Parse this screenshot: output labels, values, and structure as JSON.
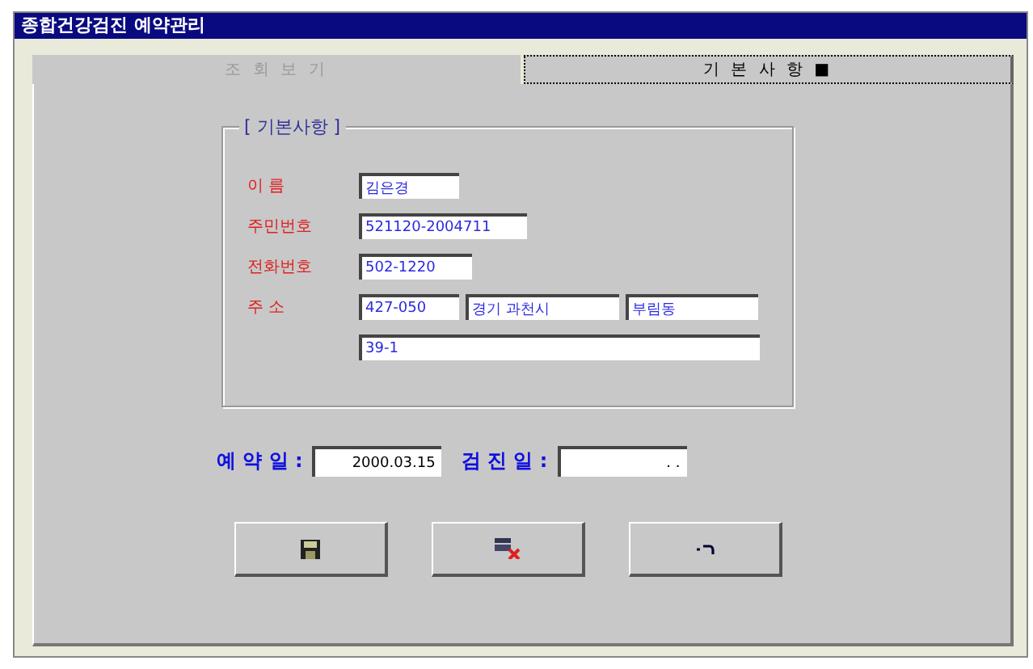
{
  "window": {
    "title": "종합건강검진 예약관리"
  },
  "tabs": [
    {
      "label": "조 회 보 기",
      "selected": false
    },
    {
      "label": "기 본 사 항 ■",
      "selected": true
    }
  ],
  "group": {
    "legend": "[ 기본사항 ]",
    "fields": [
      {
        "label": "이 름",
        "values": [
          "김은경"
        ]
      },
      {
        "label": "주민번호",
        "values": [
          "521120-2004711"
        ]
      },
      {
        "label": "전화번호",
        "values": [
          "502-1220"
        ]
      },
      {
        "label": "주 소",
        "values": [
          "427-050",
          "경기 과천시",
          "부림동"
        ]
      },
      {
        "values": [
          "39-1"
        ]
      }
    ]
  },
  "dates": [
    {
      "label": "예 약 일 :",
      "value": "2000.03.15"
    },
    {
      "label": "검 진 일 :",
      "value": ". ."
    }
  ],
  "buttons": [
    {
      "kind": "save"
    },
    {
      "kind": "delete"
    },
    {
      "kind": "undo"
    }
  ]
}
